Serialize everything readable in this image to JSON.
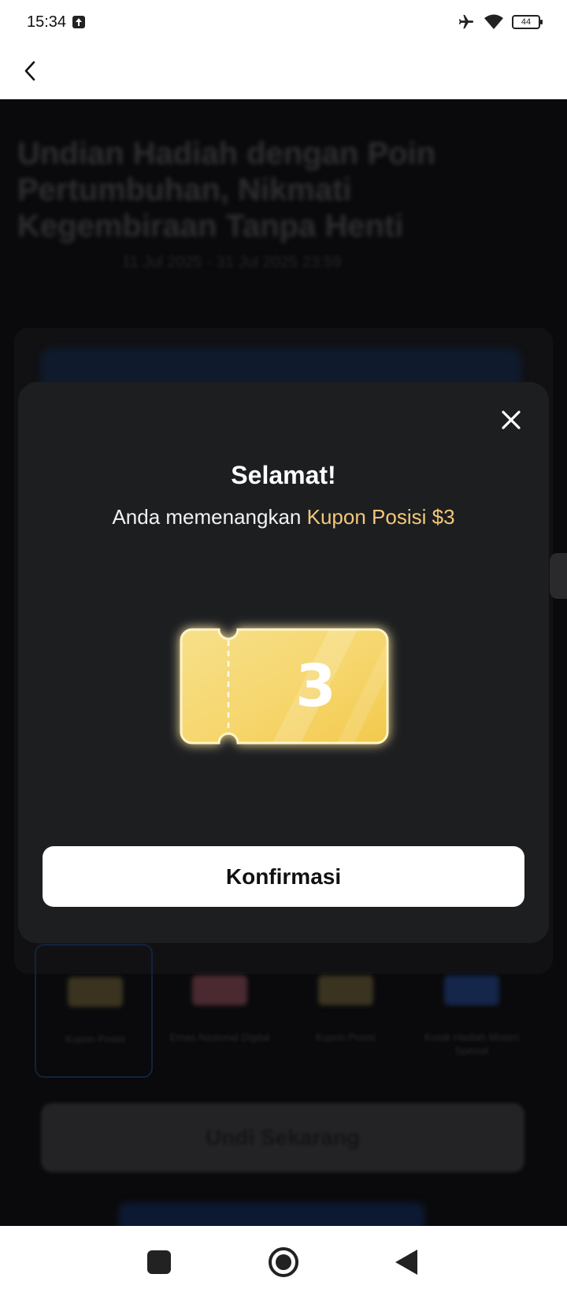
{
  "status_bar": {
    "time": "15:34",
    "battery": "44"
  },
  "background_page": {
    "title": "Undian Hadiah dengan Poin Pertumbuhan, Nikmati Kegembiraan Tanpa Henti",
    "subtitle": "11 Jul 2025 - 31 Jul 2025 23:59",
    "tiles": [
      {
        "label": "Kupon Posisi",
        "color": "#3a3320"
      },
      {
        "label": "Emas Nasional Digital",
        "color": "#4a2a30"
      },
      {
        "label": "Kupon Posisi",
        "color": "#3a3320"
      },
      {
        "label": "Kotak Hadiah Misteri Spesial",
        "color": "#14264a"
      }
    ],
    "main_button": "Undi Sekarang"
  },
  "modal": {
    "title": "Selamat!",
    "message_prefix": "Anda memenangkan ",
    "message_highlight": "Kupon Posisi $3",
    "ticket_value": "3",
    "confirm_label": "Konfirmasi"
  },
  "colors": {
    "modal_bg": "#1d1e20",
    "highlight": "#f3c879",
    "ticket_gold": "#f5d36a"
  }
}
